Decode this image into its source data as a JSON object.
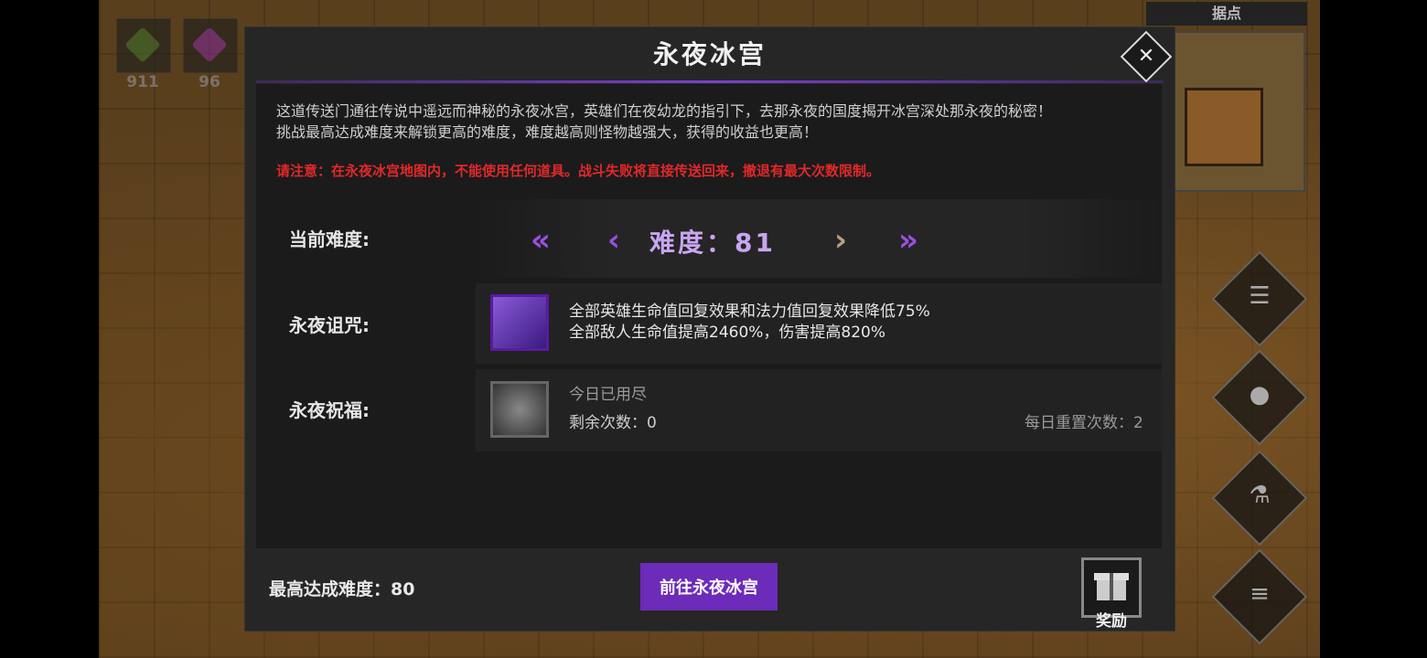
{
  "background": {
    "resources": [
      {
        "icon": "green-feather-icon",
        "count": "911",
        "color": "#4a8a3a"
      },
      {
        "icon": "purple-feather-icon",
        "count": "96",
        "color": "#8a3aa0"
      }
    ],
    "minimap_title": "据点"
  },
  "dialog": {
    "title": "永夜冰宫",
    "description_line1": "这道传送门通往传说中遥远而神秘的永夜冰宫，英雄们在夜幼龙的指引下，去那永夜的国度揭开冰宫深处那永夜的秘密！",
    "description_line2": "挑战最高达成难度来解锁更高的难度，难度越高则怪物越强大，获得的收益也更高！",
    "warning": "请注意：在永夜冰宫地图内，不能使用任何道具。战斗失败将直接传送回来，撤退有最大次数限制。",
    "difficulty": {
      "label": "当前难度:",
      "value_text": "难度：81"
    },
    "curse": {
      "label": "永夜诅咒:",
      "line1": "全部英雄生命值回复效果和法力值回复效果降低75%",
      "line2": "全部敌人生命值提高2460%，伤害提高820%"
    },
    "blessing": {
      "label": "永夜祝福:",
      "status": "今日已用尽",
      "remaining": "剩余次数：0",
      "daily_reset": "每日重置次数：2"
    },
    "best_difficulty": "最高达成难度：80",
    "go_button": "前往永夜冰宫",
    "reward_label": "奖励"
  },
  "colors": {
    "accent_purple": "#7b3fd0",
    "warning_red": "#e0282a",
    "button_purple": "#6c2bb8"
  }
}
